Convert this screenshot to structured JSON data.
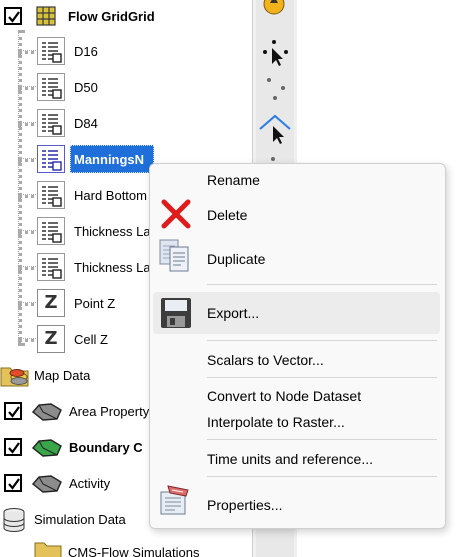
{
  "tree": {
    "root": {
      "label": "Flow GridGrid",
      "checked": true
    },
    "datasets": [
      {
        "label": "D16"
      },
      {
        "label": "D50"
      },
      {
        "label": "D84"
      },
      {
        "label": "ManningsN"
      },
      {
        "label": "Hard Bottom"
      },
      {
        "label": "Thickness La"
      },
      {
        "label": "Thickness La"
      }
    ],
    "z_items": [
      {
        "label": "Point Z"
      },
      {
        "label": "Cell Z"
      }
    ],
    "map_data": {
      "label": "Map Data"
    },
    "coverages": [
      {
        "label": "Area Property",
        "checked": true,
        "bold": false
      },
      {
        "label": "Boundary C",
        "checked": true,
        "bold": true
      },
      {
        "label": "Activity",
        "checked": true,
        "bold": false
      }
    ],
    "simulation_data": {
      "label": "Simulation Data"
    },
    "cms_flow": {
      "label": "CMS-Flow Simulations"
    }
  },
  "context_menu": {
    "rename": "Rename",
    "delete": "Delete",
    "duplicate": "Duplicate",
    "export": "Export...",
    "scalars_to_vector": "Scalars to Vector...",
    "convert_to_node": "Convert to Node Dataset",
    "interpolate_to_raster": "Interpolate to Raster...",
    "time_units": "Time units and reference...",
    "properties": "Properties..."
  },
  "colors": {
    "selection": "#1e6fd9",
    "delete_red": "#e01b1b",
    "menu_bg": "#f9f9f9",
    "hover": "#ececec"
  },
  "icons": [
    "grid-icon",
    "dataset-icon",
    "z-icon",
    "folder-icon",
    "coverage-icon",
    "database-icon",
    "delete-icon",
    "duplicate-icon",
    "save-icon",
    "properties-icon",
    "select-tool-icon",
    "select-point-icon",
    "vertex-tool-icon"
  ]
}
